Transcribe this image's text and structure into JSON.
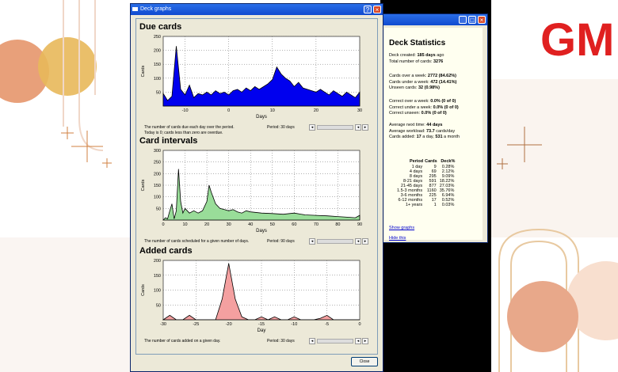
{
  "logo_text": "GM",
  "graphs_window": {
    "title": "Deck graphs",
    "close_label": "Close",
    "sections": [
      {
        "title": "Due cards",
        "caption_lines": [
          "The number of cards due each day over the period.",
          "Today is 0; cards less than zero are overdue."
        ],
        "period": "Period: 30 days"
      },
      {
        "title": "Card intervals",
        "caption_lines": [
          "The number of cards scheduled for a given number of days."
        ],
        "period": "Period: 90 days"
      },
      {
        "title": "Added cards",
        "caption_lines": [
          "The number of cards added on a given day."
        ],
        "period": "Period: 30 days"
      }
    ]
  },
  "stats_window": {
    "title": "Deck Statistics",
    "lines1": [
      {
        "label": "Deck created: ",
        "value": "185 days",
        "suffix": " ago"
      },
      {
        "label": "Total number of cards: ",
        "value": "3276",
        "suffix": ""
      }
    ],
    "lines2": [
      {
        "label": "Cards over a week: ",
        "value": "2772 (84.62%)",
        "suffix": ""
      },
      {
        "label": "Cards under a week: ",
        "value": "472 (14.41%)",
        "suffix": ""
      },
      {
        "label": "Unseen cards: ",
        "value": "32 (0.98%)",
        "suffix": ""
      }
    ],
    "lines3": [
      {
        "label": "Correct over a week: ",
        "value": "0.0% (0 of 0)",
        "suffix": ""
      },
      {
        "label": "Correct under a week: ",
        "value": "0.0% (0 of 0)",
        "suffix": ""
      },
      {
        "label": "Correct unseen: ",
        "value": "0.0% (0 of 0)",
        "suffix": ""
      }
    ],
    "lines4": [
      {
        "label": "Average next time: ",
        "value": "44 days",
        "suffix": ""
      },
      {
        "label": "Average workload: ",
        "value": "73.7",
        "suffix": " cards/day"
      },
      {
        "label": "Cards added: ",
        "value": "17",
        "suffix": " a day, "
      }
    ],
    "cards_added_month": "531",
    "cards_added_month_suffix": " a month",
    "table": {
      "headers": [
        "Period",
        "Cards",
        "Deck%"
      ],
      "rows": [
        [
          "1 day",
          "9",
          "0.28%"
        ],
        [
          "4 days",
          "69",
          "2.12%"
        ],
        [
          "8 days",
          "295",
          "9.09%"
        ],
        [
          "8-21 days",
          "591",
          "18.22%"
        ],
        [
          "21-45 days",
          "877",
          "27.03%"
        ],
        [
          "1.5-3 months",
          "1160",
          "35.76%"
        ],
        [
          "3-6 months",
          "225",
          "6.94%"
        ],
        [
          "6-12 months",
          "17",
          "0.52%"
        ],
        [
          "1+ years",
          "1",
          "0.03%"
        ]
      ]
    },
    "show_graphs": "Show graphs",
    "hide_this": "Hide this"
  },
  "chart_data": [
    {
      "type": "area",
      "title": "Due cards",
      "xlabel": "Days",
      "ylabel": "Cards",
      "xlim": [
        -15,
        30
      ],
      "ylim": [
        0,
        250
      ],
      "xticks": [
        -10,
        0,
        10,
        20,
        30
      ],
      "yticks": [
        50,
        100,
        150,
        200,
        250
      ],
      "color": "#0000ee",
      "x": [
        -15,
        -14,
        -13,
        -12,
        -11,
        -10,
        -9,
        -8,
        -7,
        -6,
        -5,
        -4,
        -3,
        -2,
        -1,
        0,
        1,
        2,
        3,
        4,
        5,
        6,
        7,
        8,
        9,
        10,
        11,
        12,
        13,
        14,
        15,
        16,
        17,
        18,
        19,
        20,
        21,
        22,
        23,
        24,
        25,
        26,
        27,
        28,
        29,
        30
      ],
      "y": [
        45,
        20,
        35,
        215,
        60,
        40,
        75,
        30,
        45,
        40,
        50,
        40,
        55,
        45,
        50,
        40,
        55,
        60,
        50,
        65,
        55,
        70,
        60,
        70,
        80,
        95,
        140,
        115,
        100,
        90,
        70,
        85,
        65,
        60,
        55,
        50,
        60,
        50,
        40,
        55,
        45,
        35,
        50,
        40,
        30,
        50
      ]
    },
    {
      "type": "area",
      "title": "Card intervals",
      "xlabel": "Days",
      "ylabel": "Cards",
      "xlim": [
        0,
        90
      ],
      "ylim": [
        0,
        300
      ],
      "xticks": [
        0,
        10,
        20,
        30,
        40,
        50,
        60,
        70,
        80,
        90
      ],
      "yticks": [
        50,
        100,
        150,
        200,
        250,
        300
      ],
      "color": "#99dd99",
      "x": [
        0,
        1,
        2,
        3,
        4,
        5,
        6,
        7,
        8,
        9,
        10,
        12,
        14,
        16,
        18,
        20,
        21,
        22,
        24,
        26,
        28,
        30,
        32,
        34,
        36,
        38,
        40,
        45,
        50,
        55,
        60,
        65,
        70,
        75,
        80,
        85,
        88,
        90
      ],
      "y": [
        0,
        10,
        5,
        40,
        70,
        5,
        40,
        220,
        80,
        30,
        50,
        30,
        40,
        30,
        40,
        80,
        150,
        120,
        70,
        50,
        45,
        40,
        45,
        35,
        30,
        40,
        35,
        30,
        28,
        25,
        30,
        22,
        20,
        18,
        15,
        12,
        10,
        20
      ]
    },
    {
      "type": "area",
      "title": "Added cards",
      "xlabel": "Day",
      "ylabel": "Cards",
      "xlim": [
        -30,
        0
      ],
      "ylim": [
        0,
        200
      ],
      "xticks": [
        -30,
        -25,
        -20,
        -15,
        -10,
        -5,
        0
      ],
      "yticks": [
        50,
        100,
        150,
        200
      ],
      "color": "#f4a0a0",
      "x": [
        -30,
        -29,
        -28,
        -27,
        -26,
        -25,
        -24,
        -23,
        -22,
        -21,
        -20,
        -19,
        -18,
        -17,
        -16,
        -15,
        -14,
        -13,
        -12,
        -11,
        -10,
        -9,
        -8,
        -7,
        -6,
        -5,
        -4,
        -3,
        -2,
        -1,
        0
      ],
      "y": [
        0,
        15,
        0,
        0,
        15,
        0,
        0,
        0,
        0,
        70,
        190,
        70,
        10,
        0,
        0,
        10,
        0,
        10,
        0,
        0,
        10,
        0,
        0,
        0,
        5,
        15,
        0,
        0,
        0,
        0,
        0
      ]
    }
  ]
}
